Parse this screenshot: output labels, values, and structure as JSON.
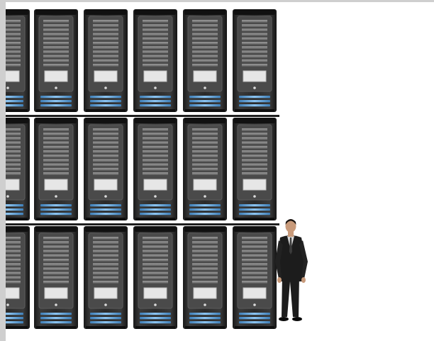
{
  "scene": {
    "description_label": "",
    "rack_rows": 3,
    "rack_columns": 6,
    "colors": {
      "frame_border": "#cfcfcf",
      "background": "#ffffff",
      "server_body": "#2a2a2a",
      "server_bezel": "#4a4a4a",
      "vent": "#8a8a8a",
      "display_panel": "#e6e6e6",
      "led_blue": "#6fa8dc",
      "shelf": "#1f1f1f",
      "suit": "#1c1c1c",
      "skin": "#c89a7a",
      "shirt": "#d9d9d9",
      "tie": "#3b3b3b"
    },
    "icons": {
      "server": "server-unit-icon",
      "person": "businessman-figure"
    }
  }
}
